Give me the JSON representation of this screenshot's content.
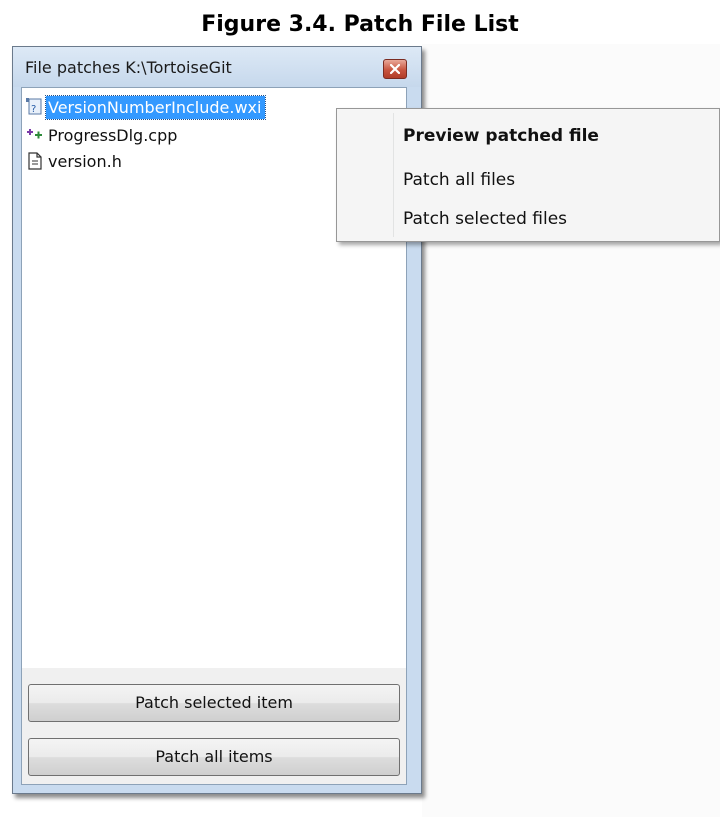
{
  "figure": {
    "title": "Figure 3.4. Patch File List"
  },
  "window": {
    "title": "File patches  K:\\TortoiseGit"
  },
  "files": [
    {
      "name": "VersionNumberInclude.wxi",
      "icon": "conflict-file-icon",
      "selected": true
    },
    {
      "name": "ProgressDlg.cpp",
      "icon": "added-file-icon",
      "selected": false
    },
    {
      "name": "version.h",
      "icon": "document-file-icon",
      "selected": false
    }
  ],
  "buttons": {
    "patch_selected": "Patch selected item",
    "patch_all": "Patch all items"
  },
  "context_menu": {
    "items": [
      {
        "label": "Preview patched file",
        "default": true
      },
      {
        "label": "Patch all files",
        "default": false
      },
      {
        "label": "Patch selected files",
        "default": false
      }
    ]
  },
  "colors": {
    "selection": "#3399ff",
    "window_frame": "#c9dbef",
    "close_button": "#c8553f"
  }
}
